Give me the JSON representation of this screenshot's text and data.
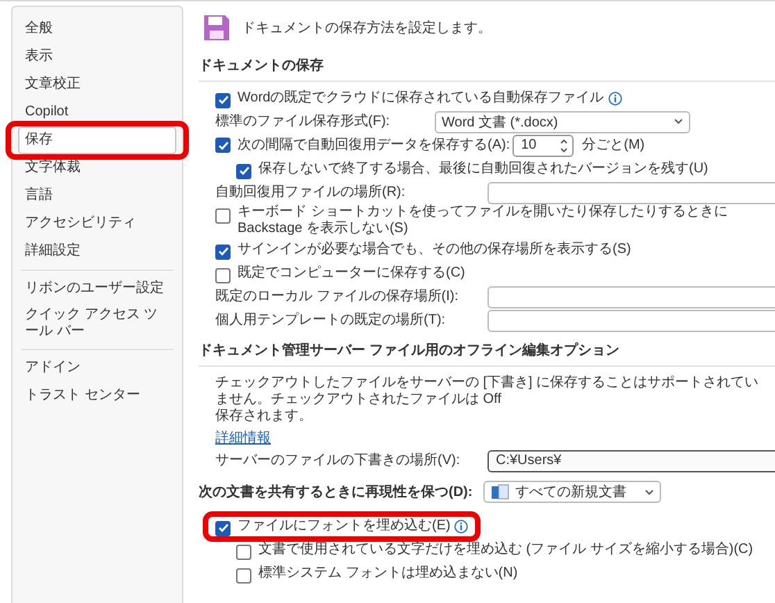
{
  "sidebar": {
    "groups": [
      {
        "items": [
          {
            "label": "全般",
            "selected": false,
            "highlighted": false
          },
          {
            "label": "表示",
            "selected": false,
            "highlighted": false
          },
          {
            "label": "文章校正",
            "selected": false,
            "highlighted": false
          },
          {
            "label": "Copilot",
            "selected": false,
            "highlighted": false
          },
          {
            "label": "保存",
            "selected": true,
            "highlighted": true
          },
          {
            "label": "文字体裁",
            "selected": false,
            "highlighted": false
          },
          {
            "label": "言語",
            "selected": false,
            "highlighted": false
          },
          {
            "label": "アクセシビリティ",
            "selected": false,
            "highlighted": false
          },
          {
            "label": "詳細設定",
            "selected": false,
            "highlighted": false
          }
        ]
      },
      {
        "items": [
          {
            "label": "リボンのユーザー設定",
            "selected": false,
            "highlighted": false
          },
          {
            "label": "クイック アクセス ツール バー",
            "selected": false,
            "highlighted": false
          }
        ]
      },
      {
        "items": [
          {
            "label": "アドイン",
            "selected": false,
            "highlighted": false
          },
          {
            "label": "トラスト センター",
            "selected": false,
            "highlighted": false
          }
        ]
      }
    ]
  },
  "header": {
    "text": "ドキュメントの保存方法を設定します。"
  },
  "sections": [
    {
      "title": "ドキュメントの保存",
      "rows": [
        {
          "kind": "checkbox",
          "label": "Wordの既定でクラウドに保存されている自動保存ファイル",
          "checked": true,
          "info": true,
          "indent": false,
          "highlighted": false
        },
        {
          "kind": "select",
          "label": "標準のファイル保存形式(F):",
          "value": "Word 文書 (*.docx)"
        },
        {
          "kind": "spin",
          "label": "次の間隔で自動回復用データを保存する(A):",
          "checked": true,
          "value": "10",
          "unit": "分ごと(M)"
        },
        {
          "kind": "checkbox",
          "label": "保存しないで終了する場合、最後に自動回復されたバージョンを残す(U)",
          "checked": true,
          "info": false,
          "indent": true,
          "highlighted": false
        },
        {
          "kind": "field",
          "label": "自動回復用ファイルの場所(R):"
        },
        {
          "kind": "checkbox",
          "label": "キーボード ショートカットを使ってファイルを開いたり保存したりするときに Backstage を表示しない(S)",
          "checked": false,
          "info": false,
          "indent": false,
          "highlighted": false
        },
        {
          "kind": "checkbox",
          "label": "サインインが必要な場合でも、その他の保存場所を表示する(S)",
          "checked": true,
          "info": false,
          "indent": false,
          "highlighted": false
        },
        {
          "kind": "checkbox",
          "label": "既定でコンピューターに保存する(C)",
          "checked": false,
          "info": false,
          "indent": false,
          "highlighted": false
        },
        {
          "kind": "field",
          "label": "既定のローカル ファイルの保存場所(I):"
        },
        {
          "kind": "field",
          "label": "個人用テンプレートの既定の場所(T):"
        }
      ]
    },
    {
      "title": "ドキュメント管理サーバー ファイル用のオフライン編集オプション",
      "rows": [
        {
          "kind": "text",
          "label": "チェックアウトしたファイルをサーバーの [下書き] に保存することはサポートされていません。チェックアウトされたファイルは Off",
          "line2": "保存されます。"
        },
        {
          "kind": "link",
          "label": "詳細情報"
        },
        {
          "kind": "field",
          "label": "サーバーのファイルの下書きの場所(V):",
          "value": "C:¥Users¥"
        }
      ]
    },
    {
      "title": "次の文書を共有するときに再現性を保つ(D):",
      "select": "すべての新規文書",
      "rows": [
        {
          "kind": "checkbox",
          "label": "ファイルにフォントを埋め込む(E)",
          "checked": true,
          "info": true,
          "indent": false,
          "highlighted": true
        },
        {
          "kind": "checkbox",
          "label": "文書で使用されている文字だけを埋め込む (ファイル サイズを縮小する場合)(C)",
          "checked": false,
          "info": false,
          "indent": true,
          "highlighted": false
        },
        {
          "kind": "checkbox",
          "label": "標準システム フォントは埋め込まない(N)",
          "checked": false,
          "info": false,
          "indent": true,
          "highlighted": false
        }
      ]
    }
  ]
}
